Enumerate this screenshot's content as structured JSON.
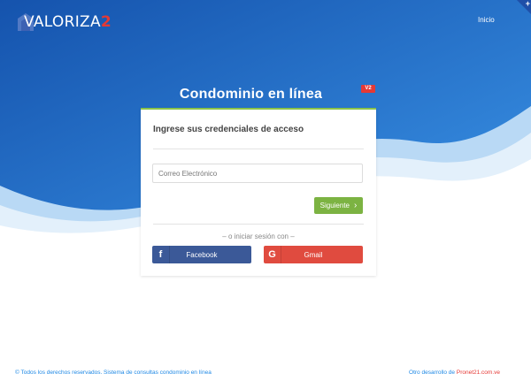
{
  "header": {
    "logo_text": "VALORIZA",
    "logo_number": "2",
    "nav_inicio": "Inicio"
  },
  "hero": {
    "title": "Condominio en línea",
    "version_badge": "V2"
  },
  "login": {
    "heading": "Ingrese sus credenciales de acceso",
    "email_placeholder": "Correo Electrónico",
    "email_value": "",
    "next_label": "Siguiente",
    "or_text": "– o iniciar sesión con –",
    "facebook_label": "Facebook",
    "gmail_label": "Gmail"
  },
  "footer": {
    "left_text": "© Todos los derechos reservados. Sistema de consultas condominio en línea",
    "right_prefix": "Otro desarrollo de",
    "right_link": "Pronet21.com.ve"
  },
  "colors": {
    "hero_blue_dark": "#1a5fb4",
    "hero_blue_light": "#3b8fe3",
    "accent_green": "#7cb342",
    "facebook": "#3b5998",
    "gmail": "#e04b3f",
    "badge_red": "#e53935"
  },
  "icons": {
    "next": "chevron-right-icon",
    "facebook": "facebook-icon",
    "gmail": "google-icon",
    "corner": "plus-icon"
  }
}
